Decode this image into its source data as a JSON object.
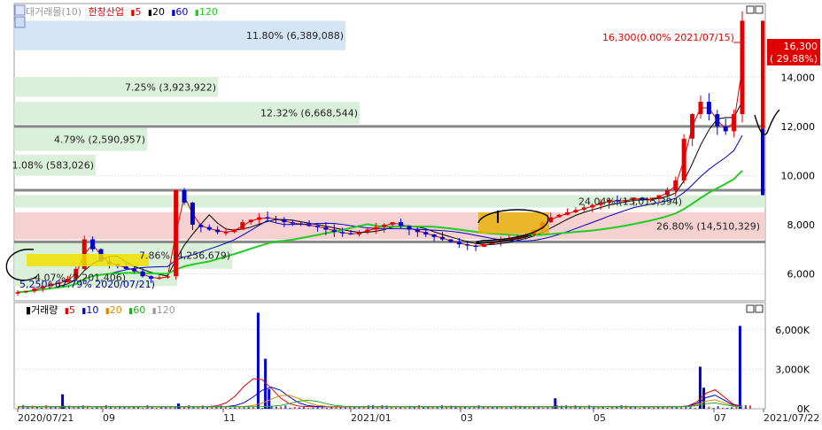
{
  "chart_data": [
    {
      "type": "candlestick",
      "stock_name": "한창산업",
      "legend": {
        "title_dim": "대거래물(10)",
        "stock": "한창산업",
        "ma": [
          {
            "label": "5",
            "color": "#e00000"
          },
          {
            "label": "20",
            "color": "#000000"
          },
          {
            "label": "60",
            "color": "#0000cc"
          },
          {
            "label": "120",
            "color": "#22cc22"
          }
        ]
      },
      "y_ticks": [
        "14,000",
        "12,000",
        "10,000",
        "8,000",
        "6,000"
      ],
      "y_tick_values": [
        14000,
        12000,
        10000,
        8000,
        6000
      ],
      "ylim": [
        4900,
        17000
      ],
      "x_ticks": [
        "2020/07/21",
        "09",
        "11",
        "2021/01",
        "03",
        "05",
        "07",
        "2021/07/22"
      ],
      "price_tag": {
        "line1": "16,300",
        "line2": "( 29.88%)"
      },
      "max_label": "16,300(0.00% 2021/07/15)",
      "min_label": "5,250(-67.79% 2020/07/21)",
      "volume_zones": [
        {
          "label": "11.80% (6,389,088)",
          "from": 16300,
          "to": 15100
        },
        {
          "label": "7.25% (3,923,922)",
          "from": 14000,
          "to": 13200
        },
        {
          "label": "12.32% (6,668,544)",
          "from": 13000,
          "to": 12100
        },
        {
          "label": "4.79% (2,590,957)",
          "from": 11950,
          "to": 11000
        },
        {
          "label": "1.08% (583,026)",
          "from": 10850,
          "to": 10000
        },
        {
          "label": "24.04% (13,015,394)",
          "from": 9200,
          "to": 8700
        },
        {
          "label": "26.80% (14,510,329)",
          "from": 8500,
          "to": 7400
        },
        {
          "label": "7.86% (4,256,679)",
          "from": 7300,
          "to": 6200
        },
        {
          "label": "4.07% (2,201,406)",
          "from": 6200,
          "to": 5500
        }
      ],
      "horizontal_lines": [
        12000,
        9400,
        7300
      ],
      "close_series_approx": [
        5250,
        5300,
        5400,
        5500,
        5600,
        5650,
        5800,
        6200,
        7400,
        7000,
        6500,
        6400,
        6300,
        6200,
        6100,
        5900,
        5800,
        5850,
        5900,
        9400,
        8900,
        8000,
        7900,
        7800,
        7700,
        7700,
        7800,
        8100,
        8200,
        8300,
        8250,
        8200,
        8100,
        8050,
        8000,
        7950,
        7900,
        7800,
        7700,
        7650,
        7600,
        7700,
        7800,
        7900,
        8000,
        8100,
        7950,
        7800,
        7700,
        7600,
        7500,
        7400,
        7300,
        7200,
        7150,
        7100,
        7200,
        7300,
        7400,
        7400,
        7500,
        7600,
        7800,
        8100,
        8300,
        8400,
        8500,
        8600,
        8700,
        8800,
        8900,
        9000,
        8950,
        9000,
        9100,
        9000,
        9050,
        9200,
        9400,
        9800,
        11500,
        12500,
        13000,
        12500,
        12000,
        11800,
        12500,
        16300
      ]
    },
    {
      "type": "bar",
      "title": "거래량",
      "legend": [
        {
          "label": "5",
          "color": "#e00000"
        },
        {
          "label": "10",
          "color": "#0000cc"
        },
        {
          "label": "20",
          "color": "#dd8800"
        },
        {
          "label": "60",
          "color": "#22aa22"
        },
        {
          "label": "120",
          "color": "#999999"
        }
      ],
      "y_ticks": [
        "6,000K",
        "3,000K",
        "0K"
      ],
      "y_tick_values": [
        6000,
        3000,
        0
      ],
      "ylim": [
        0,
        7400
      ],
      "spikes_thousands": [
        {
          "x": 0.06,
          "v": 1100
        },
        {
          "x": 0.22,
          "v": 400
        },
        {
          "x": 0.33,
          "v": 7300
        },
        {
          "x": 0.34,
          "v": 3800
        },
        {
          "x": 0.345,
          "v": 1500
        },
        {
          "x": 0.74,
          "v": 800
        },
        {
          "x": 0.94,
          "v": 3200
        },
        {
          "x": 0.945,
          "v": 1600
        },
        {
          "x": 0.995,
          "v": 6300
        }
      ]
    }
  ]
}
